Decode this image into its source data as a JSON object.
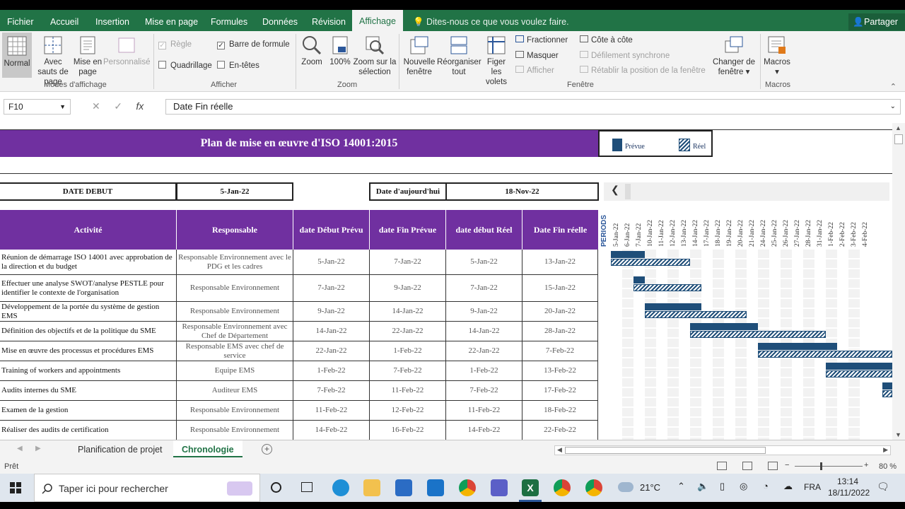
{
  "ribbon_tabs": [
    "Fichier",
    "Accueil",
    "Insertion",
    "Mise en page",
    "Formules",
    "Données",
    "Révision",
    "Affichage"
  ],
  "active_tab": "Affichage",
  "tell_me": "Dites-nous ce que vous voulez faire.",
  "share": "Partager",
  "ribbon": {
    "modes": {
      "normal": "Normal",
      "sauts": "Avec sauts de page",
      "misepage": "Mise en page",
      "perso": "Personnalisé",
      "label": "Modes d'affichage"
    },
    "afficher": {
      "regle": "Règle",
      "barre": "Barre de formule",
      "quadrillage": "Quadrillage",
      "entetes": "En-têtes",
      "label": "Afficher"
    },
    "zoom": {
      "zoom": "Zoom",
      "cent": "100%",
      "selection": "Zoom sur la sélection",
      "label": "Zoom"
    },
    "fenetre": {
      "nouvelle": "Nouvelle fenêtre",
      "reorg": "Réorganiser tout",
      "figer": "Figer les volets",
      "fractionner": "Fractionner",
      "masquer": "Masquer",
      "afficher": "Afficher",
      "cote": "Côte à côte",
      "defil": "Défilement synchrone",
      "retablir": "Rétablir la position de la fenêtre",
      "changer": "Changer de fenêtre",
      "label": "Fenêtre"
    },
    "macros": {
      "btn": "Macros",
      "label": "Macros"
    }
  },
  "name_box": "F10",
  "formula": "Date Fin réelle",
  "sheet": {
    "title": "Plan de mise en œuvre d'ISO 14001:2015",
    "legend_prevue": "Prévue",
    "legend_reel": "Réel",
    "date_debut_label": "DATE DEBUT",
    "date_debut": "5-Jan-22",
    "today_label": "Date d'aujourd'hui",
    "today": "18-Nov-22",
    "headers": [
      "Activité",
      "Responsable",
      "date Début Prévu",
      "date Fin Prévue",
      "date début Réel",
      "Date Fin réelle"
    ],
    "periods_label": "PERIODS",
    "periods": [
      "5-Jan-22",
      "6-Jan-22",
      "7-Jan-22",
      "10-Jan-22",
      "11-Jan-22",
      "12-Jan-22",
      "13-Jan-22",
      "14-Jan-22",
      "17-Jan-22",
      "18-Jan-22",
      "19-Jan-22",
      "20-Jan-22",
      "21-Jan-22",
      "24-Jan-22",
      "25-Jan-22",
      "26-Jan-22",
      "27-Jan-22",
      "28-Jan-22",
      "31-Jan-22",
      "1-Feb-22",
      "2-Feb-22",
      "3-Feb-22",
      "4-Feb-22"
    ],
    "rows": [
      {
        "act": "Réunion de démarrage ISO 14001 avec approbation de la direction et du budget",
        "resp": "Responsable Environnement avec le PDG et les cadres",
        "dp": "5-Jan-22",
        "fp": "7-Jan-22",
        "dr": "5-Jan-22",
        "fr": "13-Jan-22"
      },
      {
        "act": "Effectuer une analyse SWOT/analyse PESTLE pour identifier le contexte de l'organisation",
        "resp": "Responsable Environnement",
        "dp": "7-Jan-22",
        "fp": "9-Jan-22",
        "dr": "7-Jan-22",
        "fr": "15-Jan-22"
      },
      {
        "act": "Développement de la portée du système de gestion EMS",
        "resp": "Responsable Environnement",
        "dp": "9-Jan-22",
        "fp": "14-Jan-22",
        "dr": "9-Jan-22",
        "fr": "20-Jan-22"
      },
      {
        "act": "Définition des objectifs et de la politique du SME",
        "resp": "Responsable Environnement avec Chef de Département",
        "dp": "14-Jan-22",
        "fp": "22-Jan-22",
        "dr": "14-Jan-22",
        "fr": "28-Jan-22"
      },
      {
        "act": "Mise en œuvre des processus et procédures EMS",
        "resp": "Responsable EMS avec chef de service",
        "dp": "22-Jan-22",
        "fp": "1-Feb-22",
        "dr": "22-Jan-22",
        "fr": "7-Feb-22"
      },
      {
        "act": "Training of workers and appointments",
        "resp": "Equipe EMS",
        "dp": "1-Feb-22",
        "fp": "7-Feb-22",
        "dr": "1-Feb-22",
        "fr": "13-Feb-22"
      },
      {
        "act": "Audits internes du SME",
        "resp": "Auditeur EMS",
        "dp": "7-Feb-22",
        "fp": "11-Feb-22",
        "dr": "7-Feb-22",
        "fr": "17-Feb-22"
      },
      {
        "act": "Examen de la gestion",
        "resp": "Responsable Environnement",
        "dp": "11-Feb-22",
        "fp": "12-Feb-22",
        "dr": "11-Feb-22",
        "fr": "18-Feb-22"
      },
      {
        "act": "Réaliser des audits de certification",
        "resp": "Responsable Environnement",
        "dp": "14-Feb-22",
        "fp": "16-Feb-22",
        "dr": "14-Feb-22",
        "fr": "22-Feb-22"
      }
    ]
  },
  "sheet_tabs": [
    "Planification de projet",
    "Chronologie"
  ],
  "active_sheet": "Chronologie",
  "status": "Prêt",
  "zoom_pct": "80 %",
  "taskbar": {
    "search": "Taper ici pour rechercher",
    "weather": "21°C",
    "lang": "FRA",
    "time": "13:14",
    "date": "18/11/2022"
  }
}
